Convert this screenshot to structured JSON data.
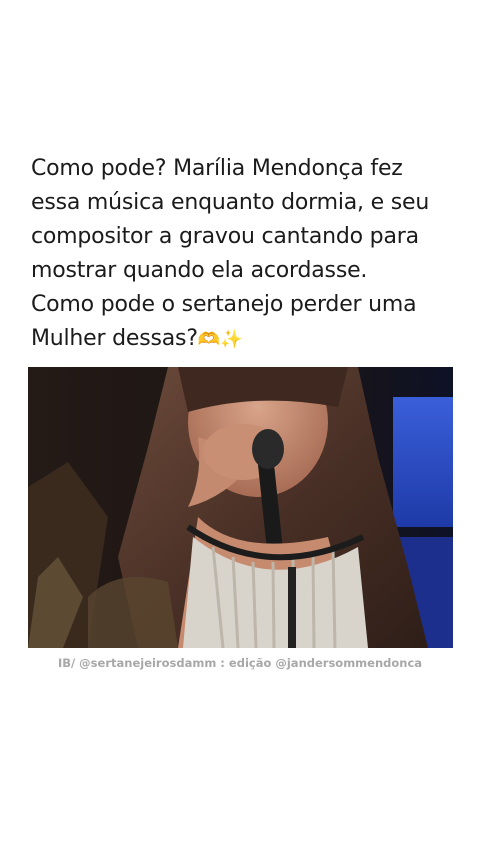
{
  "caption": {
    "lines": [
      "Como pode? Marília Mendonça fez",
      "essa música enquanto dormia, e seu",
      "compositor a gravou cantando para",
      "mostrar quando ela acordasse.",
      "Como pode o sertanejo perder uma",
      "Mulher dessas?"
    ],
    "emojis": "🫶✨"
  },
  "video": {
    "description_icon": "video-still"
  },
  "credit": "IB/ @sertanejeirosdamm : edição @jandersommendonca"
}
